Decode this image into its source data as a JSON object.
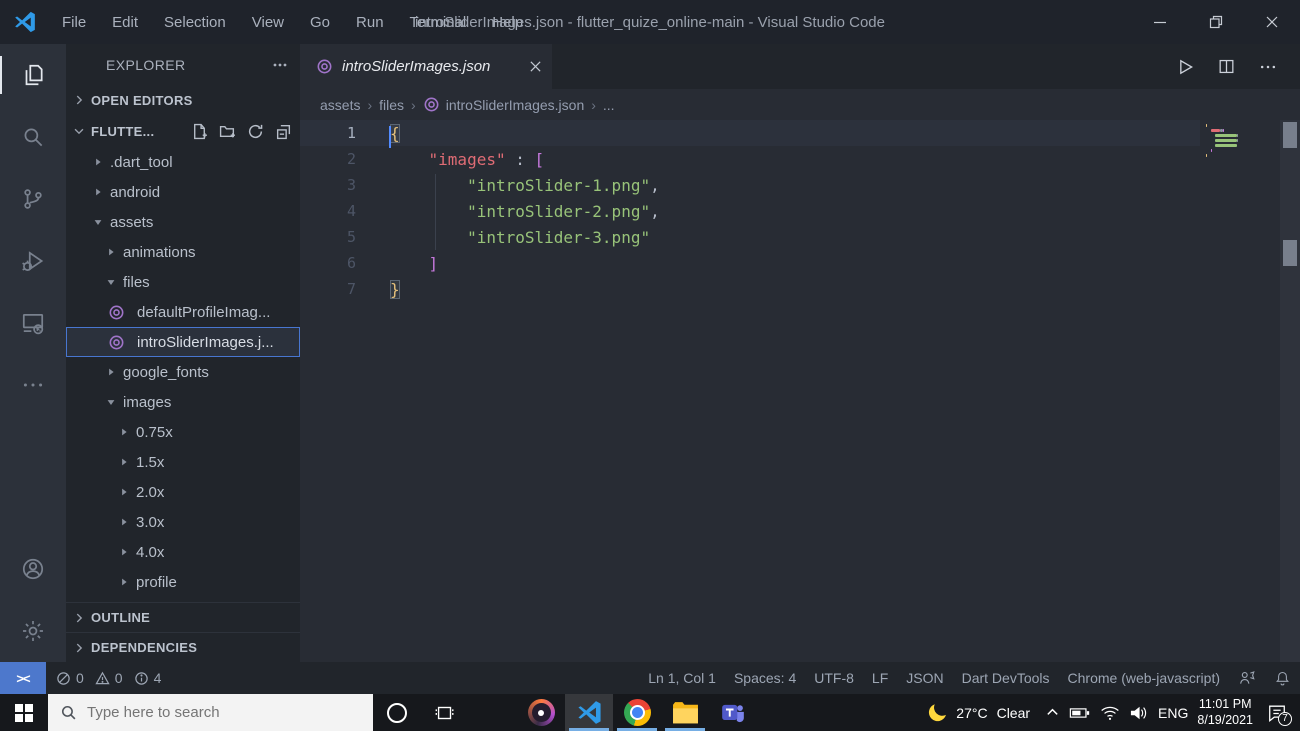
{
  "colors": {
    "accent_blue": "#4876d0",
    "remote_blue": "#4d78cc",
    "taskbar_underline": "#76aee4",
    "json_icon_purple": "#a074c9",
    "code_gold": "#e5c07b",
    "code_red": "#e06c75",
    "code_green": "#98c379",
    "code_magenta": "#c678dd"
  },
  "titlebar": {
    "menus": [
      "File",
      "Edit",
      "Selection",
      "View",
      "Go",
      "Run",
      "Terminal",
      "Help"
    ],
    "title": "introSliderImages.json - flutter_quize_online-main - Visual Studio Code"
  },
  "activity_bar": {
    "top": [
      {
        "icon": "explorer-icon",
        "active": true
      },
      {
        "icon": "search-icon",
        "active": false
      },
      {
        "icon": "source-control-icon",
        "active": false
      },
      {
        "icon": "run-debug-icon",
        "active": false
      },
      {
        "icon": "remote-explorer-icon",
        "active": false
      },
      {
        "icon": "more-icon",
        "active": false
      }
    ],
    "bottom": [
      {
        "icon": "account-icon",
        "active": false
      },
      {
        "icon": "settings-gear-icon",
        "active": false
      }
    ]
  },
  "sidebar": {
    "title": "EXPLORER",
    "open_editors_label": "OPEN EDITORS",
    "folder_label": "FLUTTE...",
    "folder_actions": [
      "new-file-icon",
      "new-folder-icon",
      "refresh-icon",
      "collapse-all-icon"
    ],
    "outline_label": "OUTLINE",
    "dependencies_label": "DEPENDENCIES",
    "tree": [
      {
        "label": ".dart_tool",
        "level": 0,
        "kind": "folder",
        "expanded": false
      },
      {
        "label": "android",
        "level": 0,
        "kind": "folder",
        "expanded": false
      },
      {
        "label": "assets",
        "level": 0,
        "kind": "folder",
        "expanded": true
      },
      {
        "label": "animations",
        "level": 1,
        "kind": "folder",
        "expanded": false
      },
      {
        "label": "files",
        "level": 1,
        "kind": "folder",
        "expanded": true
      },
      {
        "label": "defaultProfileImag...",
        "level": 2,
        "kind": "json-file"
      },
      {
        "label": "introSliderImages.j...",
        "level": 2,
        "kind": "json-file",
        "selected": true
      },
      {
        "label": "google_fonts",
        "level": 1,
        "kind": "folder",
        "expanded": false
      },
      {
        "label": "images",
        "level": 1,
        "kind": "folder",
        "expanded": true
      },
      {
        "label": "0.75x",
        "level": 2,
        "kind": "folder",
        "expanded": false
      },
      {
        "label": "1.5x",
        "level": 2,
        "kind": "folder",
        "expanded": false
      },
      {
        "label": "2.0x",
        "level": 2,
        "kind": "folder",
        "expanded": false
      },
      {
        "label": "3.0x",
        "level": 2,
        "kind": "folder",
        "expanded": false
      },
      {
        "label": "4.0x",
        "level": 2,
        "kind": "folder",
        "expanded": false
      },
      {
        "label": "profile",
        "level": 2,
        "kind": "folder",
        "expanded": false
      }
    ]
  },
  "editor": {
    "tab": {
      "label": "introSliderImages.json",
      "icon": "json-file-icon"
    },
    "actions": [
      "run-icon",
      "split-editor-icon",
      "more-actions-icon"
    ],
    "breadcrumb": [
      {
        "label": "assets"
      },
      {
        "label": "files"
      },
      {
        "label": "introSliderImages.json",
        "icon": "json-file-icon"
      },
      {
        "label": "..."
      }
    ],
    "lines": [
      {
        "num": "1",
        "current": true,
        "tokens": [
          {
            "text": "{",
            "color": "gold",
            "match": true
          }
        ]
      },
      {
        "num": "2",
        "tokens": [
          {
            "text": "    "
          },
          {
            "text": "\"images\"",
            "color": "red"
          },
          {
            "text": " : "
          },
          {
            "text": "[",
            "color": "magenta"
          }
        ]
      },
      {
        "num": "3",
        "tokens": [
          {
            "text": "        "
          },
          {
            "text": "\"introSlider-1.png\"",
            "color": "green"
          },
          {
            "text": ","
          }
        ]
      },
      {
        "num": "4",
        "tokens": [
          {
            "text": "        "
          },
          {
            "text": "\"introSlider-2.png\"",
            "color": "green"
          },
          {
            "text": ","
          }
        ]
      },
      {
        "num": "5",
        "tokens": [
          {
            "text": "        "
          },
          {
            "text": "\"introSlider-3.png\"",
            "color": "green"
          }
        ]
      },
      {
        "num": "6",
        "tokens": [
          {
            "text": "    "
          },
          {
            "text": "]",
            "color": "magenta"
          }
        ]
      },
      {
        "num": "7",
        "tokens": [
          {
            "text": "}",
            "color": "gold",
            "match": true
          }
        ]
      }
    ]
  },
  "status_bar": {
    "remote_glyph": "><",
    "problems": {
      "errors": "0",
      "warnings": "0",
      "infos": "4"
    },
    "right_items": [
      "Ln 1, Col 1",
      "Spaces: 4",
      "UTF-8",
      "LF",
      "JSON",
      "Dart DevTools",
      "Chrome (web-javascript)"
    ]
  },
  "taskbar": {
    "search_placeholder": "Type here to search",
    "apps": [
      {
        "icon": "edge-icon",
        "active": false,
        "running": false
      },
      {
        "icon": "media-disc-icon",
        "active": false,
        "running": false
      },
      {
        "icon": "vscode-icon",
        "active": true,
        "running": true
      },
      {
        "icon": "chrome-icon",
        "active": false,
        "running": true
      },
      {
        "icon": "file-explorer-icon",
        "active": false,
        "running": true
      },
      {
        "icon": "teams-icon",
        "active": false,
        "running": false
      }
    ],
    "tray": {
      "weather_temp": "27°C",
      "weather_desc": "Clear",
      "language": "ENG",
      "time": "11:01 PM",
      "date": "8/19/2021",
      "notification_count": "7"
    }
  }
}
